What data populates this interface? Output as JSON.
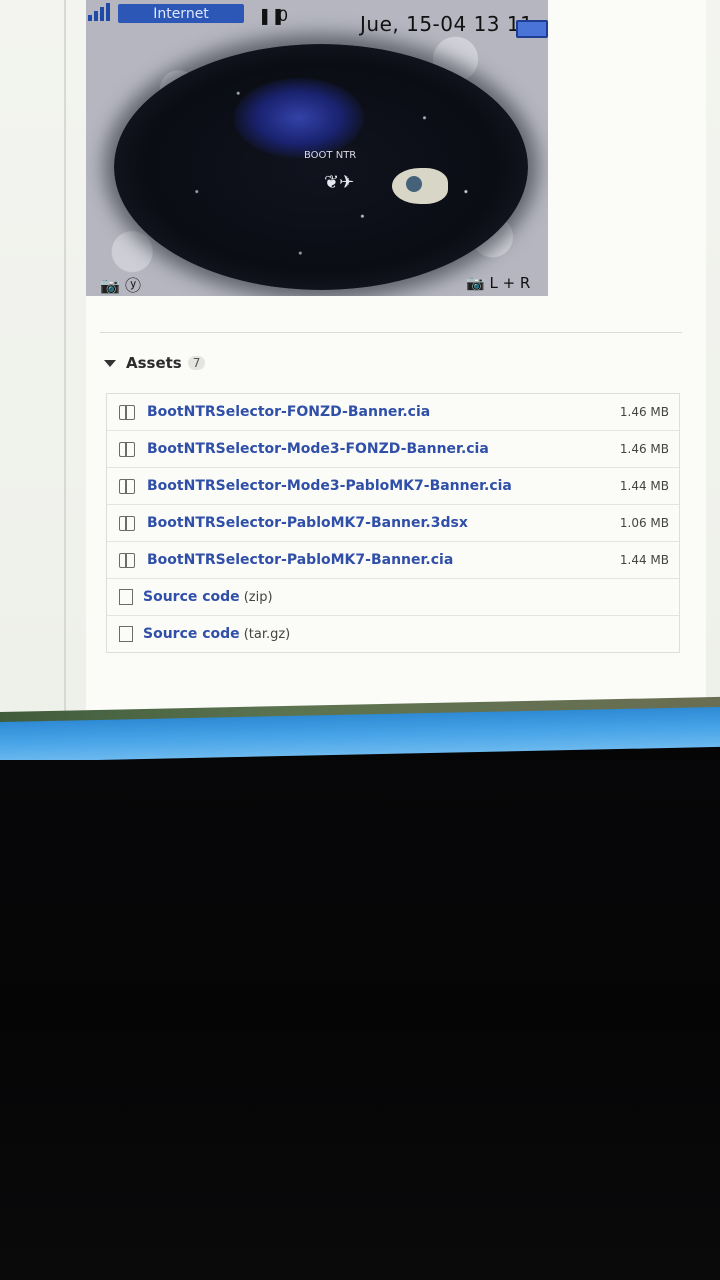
{
  "screenshot": {
    "status_internet": "Internet",
    "steps_count": "0",
    "clock": "Jue, 15-04  13 11",
    "boot_label": "BOOT NTR",
    "footer_left": "📷 ⓨ",
    "footer_right": "📷 L + R"
  },
  "assets": {
    "title": "Assets",
    "count": "7",
    "files": [
      {
        "name": "BootNTRSelector-FONZD-Banner.cia",
        "size": "1.46 MB"
      },
      {
        "name": "BootNTRSelector-Mode3-FONZD-Banner.cia",
        "size": "1.46 MB"
      },
      {
        "name": "BootNTRSelector-Mode3-PabloMK7-Banner.cia",
        "size": "1.44 MB"
      },
      {
        "name": "BootNTRSelector-PabloMK7-Banner.3dsx",
        "size": "1.06 MB"
      },
      {
        "name": "BootNTRSelector-PabloMK7-Banner.cia",
        "size": "1.44 MB"
      }
    ],
    "source": [
      {
        "label": "Source code",
        "ext": "(zip)"
      },
      {
        "label": "Source code",
        "ext": "(tar.gz)"
      }
    ]
  },
  "colors": {
    "link": "#2f4fa8",
    "bezel_blue": "#2e8ad4"
  }
}
